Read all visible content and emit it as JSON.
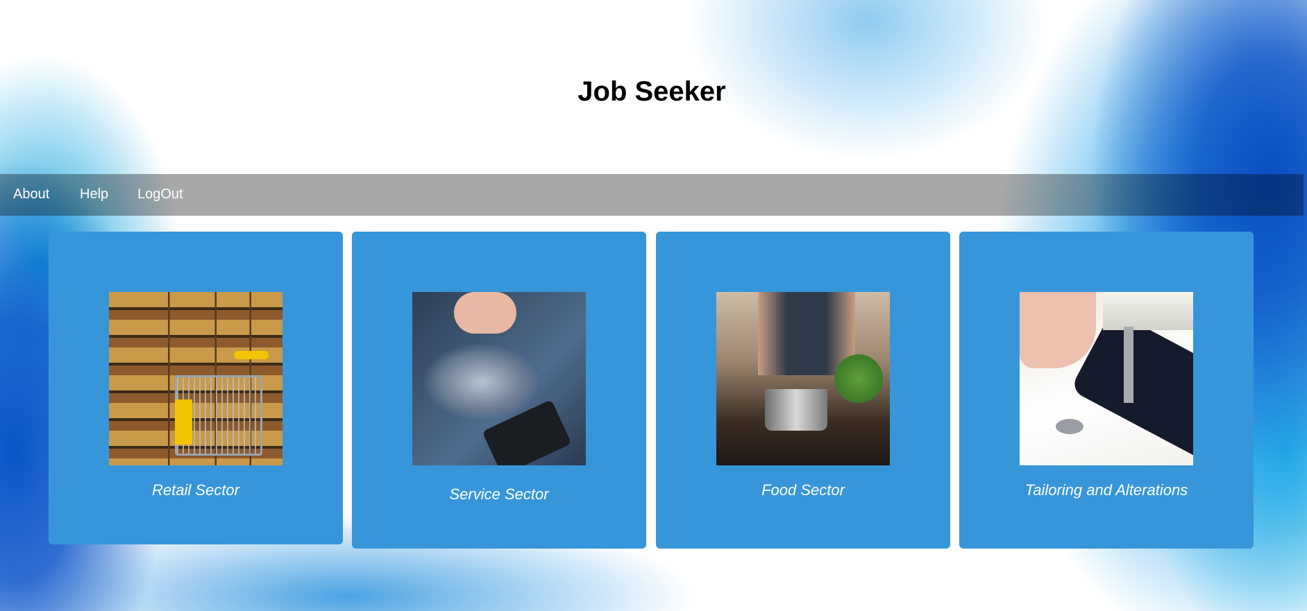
{
  "header": {
    "title": "Job Seeker"
  },
  "nav": {
    "items": [
      {
        "label": "About"
      },
      {
        "label": "Help"
      },
      {
        "label": "LogOut"
      }
    ]
  },
  "cards": [
    {
      "label": "Retail Sector",
      "image": "supermarket-shopping-cart-photo"
    },
    {
      "label": "Service Sector",
      "image": "phone-repair-photo"
    },
    {
      "label": "Food Sector",
      "image": "cooking-pot-photo"
    },
    {
      "label": "Tailoring and Alterations",
      "image": "sewing-machine-photo"
    }
  ],
  "colors": {
    "card": "#3796d9",
    "nav": "rgba(0,0,0,0.34)",
    "text_on_card": "#ffffff"
  }
}
